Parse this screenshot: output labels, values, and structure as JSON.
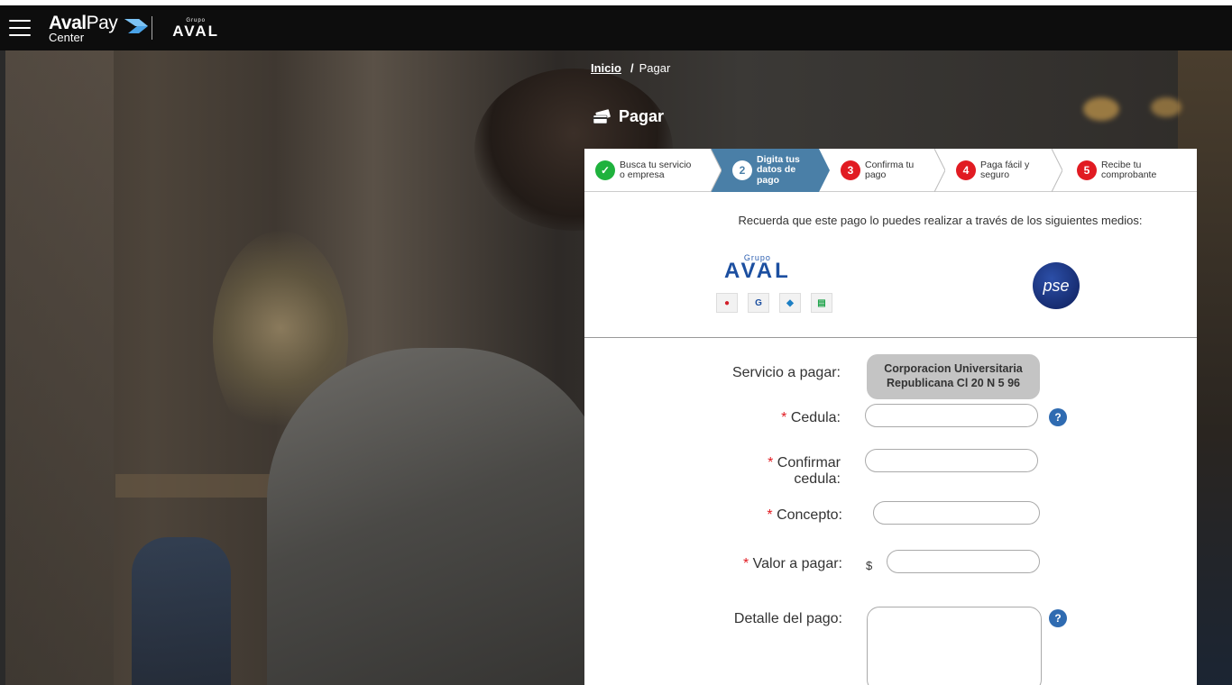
{
  "header": {
    "brand_main": "Aval",
    "brand_pay": "Pay",
    "brand_sub": "Center",
    "grupo_small": "Grupo",
    "grupo_main": "AVAL",
    "menu_icon": "hamburger-menu-icon"
  },
  "breadcrumb": {
    "home": "Inicio",
    "separator": "/",
    "current": "Pagar"
  },
  "page": {
    "title": "Pagar",
    "title_icon": "payment-card-icon"
  },
  "stepper": {
    "steps": [
      {
        "number": "✓",
        "label_line1": "Busca tu servicio",
        "label_line2": "o empresa",
        "state": "done"
      },
      {
        "number": "2",
        "label_line1": "Digita tus",
        "label_line2": "datos de pago",
        "state": "active"
      },
      {
        "number": "3",
        "label_line1": "Confirma tu",
        "label_line2": "pago",
        "state": "pending"
      },
      {
        "number": "4",
        "label_line1": "Paga fácil y",
        "label_line2": "seguro",
        "state": "pending"
      },
      {
        "number": "5",
        "label_line1": "Recibe tu",
        "label_line2": "comprobante",
        "state": "pending"
      }
    ],
    "colors": {
      "done": "#1fb23d",
      "active": "#4a7fa7",
      "pending": "#e11b22"
    }
  },
  "methods": {
    "text": "Recuerda que este pago lo puedes realizar a través de los siguientes medios:",
    "aval_small": "Grupo",
    "aval_main": "AVAL",
    "pse_label": "pse"
  },
  "form": {
    "service_label": "Servicio a pagar:",
    "service_value": "Corporacion Universitaria Republicana Cl 20 N 5 96",
    "cedula_label": "Cedula:",
    "confirm_cedula_label": "Confirmar cedula:",
    "concepto_label": "Concepto:",
    "valor_label": "Valor a pagar:",
    "currency": "$",
    "detalle_label": "Detalle del pago:",
    "required_mark": "*",
    "help_mark": "?",
    "cedula_value": "",
    "confirm_cedula_value": "",
    "concepto_value": "",
    "valor_value": "",
    "detalle_value": ""
  }
}
